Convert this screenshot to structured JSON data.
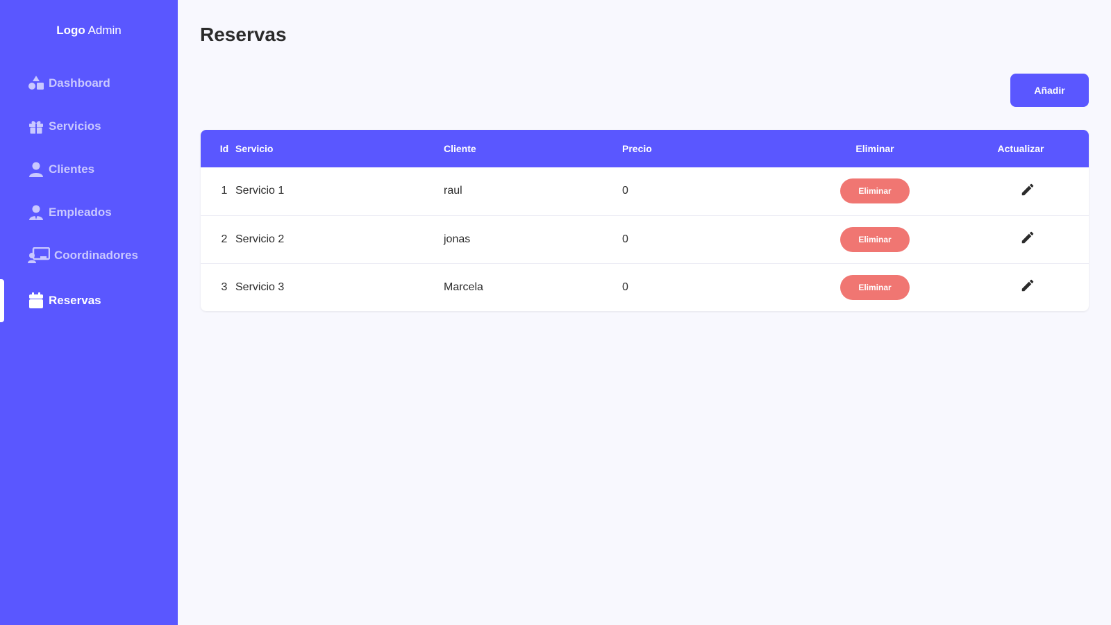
{
  "sidebar": {
    "logo_bold": "Logo",
    "logo_rest": " Admin",
    "items": [
      {
        "label": "Dashboard",
        "icon": "shapes-icon"
      },
      {
        "label": "Servicios",
        "icon": "gift-icon"
      },
      {
        "label": "Clientes",
        "icon": "user-icon"
      },
      {
        "label": "Empleados",
        "icon": "user-tie-icon"
      },
      {
        "label": "Coordinadores",
        "icon": "chalkboard-user-icon"
      },
      {
        "label": "Reservas",
        "icon": "calendar-icon",
        "active": true
      }
    ]
  },
  "main": {
    "title": "Reservas",
    "add_label": "Añadir",
    "table": {
      "headers": [
        "Id",
        "Servicio",
        "Cliente",
        "Precio",
        "Eliminar",
        "Actualizar"
      ],
      "rows": [
        {
          "id": "1",
          "servicio": "Servicio 1",
          "cliente": "raul",
          "precio": "0",
          "eliminar": "Eliminar"
        },
        {
          "id": "2",
          "servicio": "Servicio 2",
          "cliente": "jonas",
          "precio": "0",
          "eliminar": "Eliminar"
        },
        {
          "id": "3",
          "servicio": "Servicio 3",
          "cliente": "Marcela",
          "precio": "0",
          "eliminar": "Eliminar"
        }
      ]
    }
  },
  "colors": {
    "sidebar_bg": "#5a57ff",
    "accent": "#5a57ff",
    "delete": "#f07672",
    "page_bg": "#f8f8fe"
  }
}
